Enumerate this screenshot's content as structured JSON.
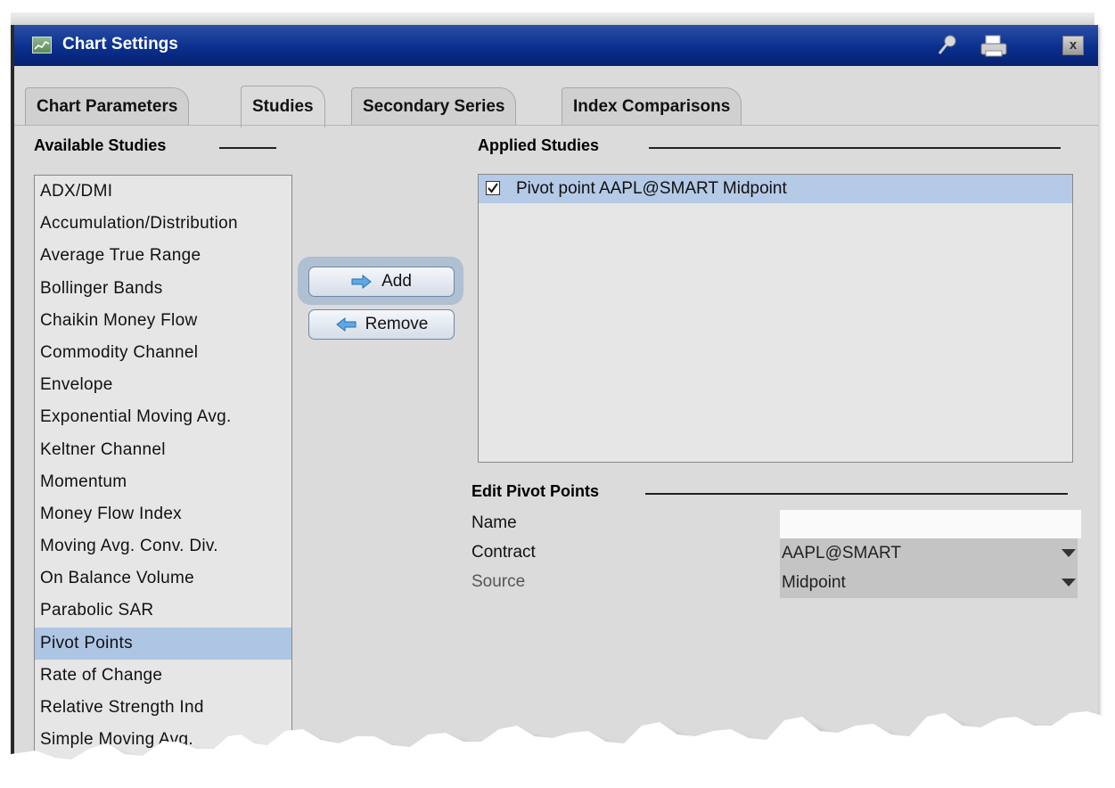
{
  "window": {
    "title": "Chart Settings"
  },
  "tabs": [
    {
      "label": "Chart Parameters"
    },
    {
      "label": "Studies"
    },
    {
      "label": "Secondary Series"
    },
    {
      "label": "Index Comparisons"
    }
  ],
  "active_tab": "Studies",
  "available": {
    "heading": "Available Studies",
    "items": [
      "ADX/DMI",
      "Accumulation/Distribution",
      "Average True Range",
      "Bollinger Bands",
      "Chaikin Money Flow",
      "Commodity Channel",
      "Envelope",
      "Exponential Moving Avg.",
      "Keltner Channel",
      "Momentum",
      "Money Flow Index",
      "Moving Avg. Conv. Div.",
      "On Balance Volume",
      "Parabolic SAR",
      "Pivot Points",
      "Rate of Change",
      "Relative Strength Ind",
      "Simple Moving Avg."
    ],
    "selected": "Pivot Points"
  },
  "buttons": {
    "add": "Add",
    "remove": "Remove"
  },
  "applied": {
    "heading": "Applied Studies",
    "items": [
      {
        "label": "Pivot point AAPL@SMART Midpoint",
        "checked": true
      }
    ]
  },
  "edit": {
    "heading": "Edit Pivot Points",
    "name_label": "Name",
    "name_value": "",
    "contract_label": "Contract",
    "contract_value": "AAPL@SMART",
    "source_label": "Source",
    "source_value": "Midpoint"
  },
  "colors": {
    "titlebar": "#0a2f8e",
    "selection": "#aec6e4",
    "panel": "#dbdbdb"
  }
}
